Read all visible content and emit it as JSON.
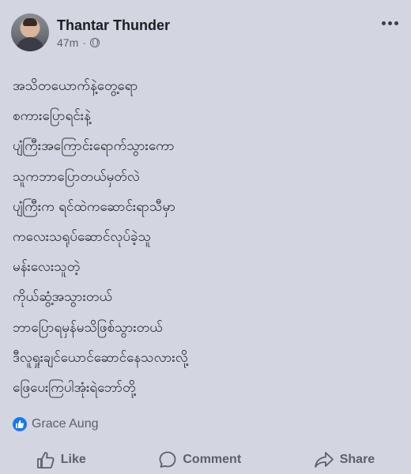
{
  "post": {
    "author": "Thantar Thunder",
    "time": "47m",
    "separator": "·",
    "privacy_icon": "globe-icon",
    "lines": [
      "အသိတယောက်နဲ့တွေ့ရော",
      "စကားပြောရင်းနဲ့",
      "ပျံကြီးအကြောင်းရောက်သွားကော",
      "သူကဘာပြောတယ်မှတ်လဲ",
      "ပျံကြီးက ရင်ထဲကဆောင်းရာသီမှာ",
      "ကလေးသရုပ်ဆောင်လုပ်ခဲ့သူ",
      "မန်းလေးသူတဲ့",
      "ကိုယ်ဆွံ့အသွားတယ်",
      "ဘာပြောရမှန်မသိဖြစ်သွားတယ်",
      "ဒီလူရှုးချင်ယောင်ဆောင်နေသလားလို့",
      "ဖြေပေးကြပါအုံးရဲဘော်တို့"
    ]
  },
  "reactions": {
    "name": "Grace Aung",
    "icon": "like-reaction-icon",
    "color": "#1877f2"
  },
  "actions": {
    "like": "Like",
    "comment": "Comment",
    "share": "Share"
  }
}
